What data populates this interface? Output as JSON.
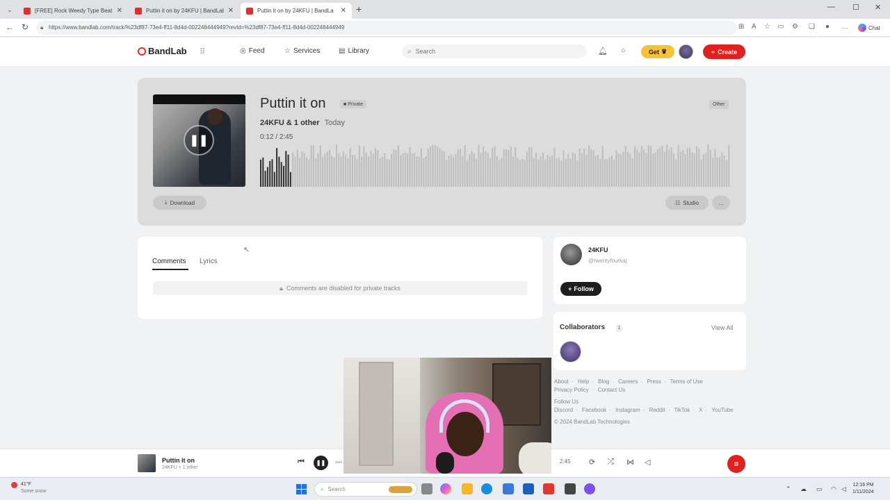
{
  "browser": {
    "tabs": [
      {
        "title": "[FREE] Rock Weedy Type Beat - \"C",
        "active": false
      },
      {
        "title": "Puttin it on by 24KFU | BandLab",
        "active": false
      },
      {
        "title": "Puttin it on by 24KFU | BandLa",
        "active": true
      }
    ],
    "url": "https://www.bandlab.com/track/%23df87-73e4-ff11-8d4d-002248444949?revId=%23df87-73e4-ff11-8d4d-002248444949",
    "copilot_label": "Chat"
  },
  "header": {
    "logo": "BandLab",
    "nav": [
      "Feed",
      "Services",
      "Library"
    ],
    "search_placeholder": "Search",
    "get_label": "Get",
    "create_label": "Create"
  },
  "track": {
    "title": "Puttin it on",
    "private_badge": "Private",
    "genre_badge": "Other",
    "artist": "24KFU",
    "collab_suffix": "& 1 other",
    "posted": "Today",
    "time_current": "0:12",
    "time_separator": "/",
    "time_total": "2:45",
    "progress": 0.07,
    "download_label": "Download",
    "studio_label": "Studio",
    "more_label": "..."
  },
  "comments": {
    "tabs": [
      "Comments",
      "Lyrics"
    ],
    "disabled_message": "Comments are disabled for private tracks"
  },
  "artist_card": {
    "name": "24KFU",
    "handle": "@twentyfourkaj",
    "follow_label": "Follow"
  },
  "collaborators": {
    "title": "Collaborators",
    "count": "1",
    "view_all": "View All"
  },
  "footer": {
    "links_row1": [
      "About",
      "Help",
      "Blog",
      "Careers",
      "Press",
      "Terms of Use"
    ],
    "links_row2": [
      "Privacy Policy",
      "Contact Us"
    ],
    "follow_us": "Follow Us",
    "social": [
      "Discord",
      "Facebook",
      "Instagram",
      "Reddit",
      "TikTok",
      "X",
      "YouTube"
    ],
    "copyright": "© 2024 BandLab Technologies"
  },
  "player": {
    "title": "Puttin it on",
    "meta": "24KFU + 1 other",
    "duration": "2:45"
  },
  "taskbar": {
    "weather_temp": "41°F",
    "weather_desc": "Some snow",
    "search_label": "Search",
    "time": "12:16 PM",
    "date": "1/11/2024"
  },
  "colors": {
    "brand_red": "#e12020",
    "get_yellow": "#f7c234",
    "wave_played": "#2f2f2f",
    "wave_unplayed": "#bdbdbd"
  }
}
